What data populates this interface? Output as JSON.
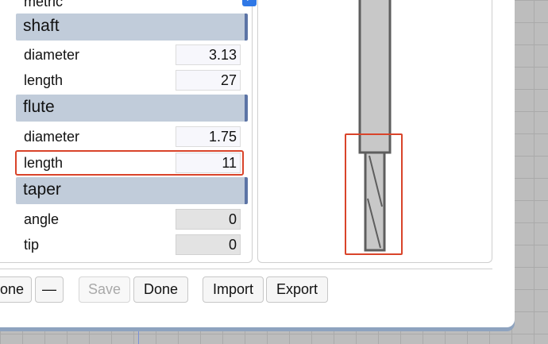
{
  "metric": {
    "label": "metric",
    "checked": true
  },
  "sections": {
    "shaft": {
      "title": "shaft",
      "diameter_label": "diameter",
      "diameter_value": "3.13",
      "length_label": "length",
      "length_value": "27"
    },
    "flute": {
      "title": "flute",
      "diameter_label": "diameter",
      "diameter_value": "1.75",
      "length_label": "length",
      "length_value": "11"
    },
    "taper": {
      "title": "taper",
      "angle_label": "angle",
      "angle_value": "0",
      "tip_label": "tip",
      "tip_value": "0"
    }
  },
  "buttons": {
    "done_partial": "one",
    "minus": "—",
    "save": "Save",
    "done": "Done",
    "import": "Import",
    "export": "Export"
  },
  "colors": {
    "section_header": "#c1ccda",
    "accent": "#5c74a5",
    "highlight": "#d9442a",
    "checkbox": "#2f78e6"
  }
}
